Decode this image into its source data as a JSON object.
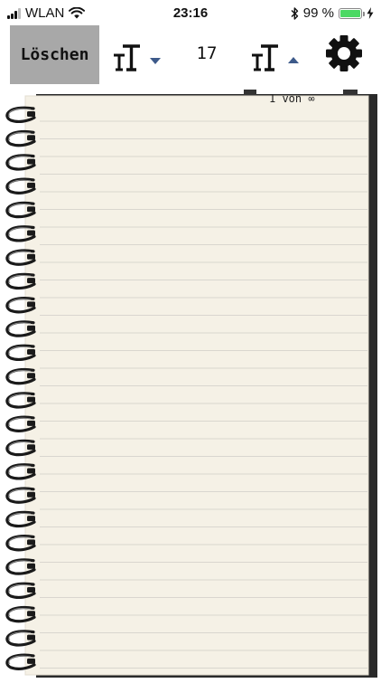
{
  "status_bar": {
    "carrier": "WLAN",
    "time": "23:16",
    "battery_percent": "99 %",
    "battery_level": 0.99,
    "icons": [
      "signal-icon",
      "wifi-icon",
      "bluetooth-icon",
      "battery-icon",
      "charging-icon"
    ]
  },
  "toolbar": {
    "clear_label": "Löschen",
    "font_size": "17",
    "icons": [
      "decrease-font-icon",
      "increase-font-icon",
      "settings-gear-icon"
    ]
  },
  "notebook": {
    "page_indicator": "1 von ∞"
  },
  "colors": {
    "clear_button_bg": "#a8a8a8",
    "paper": "#f5f1e6",
    "rule_line": "#d9d6cf",
    "arrow": "#3d5a8a",
    "battery_fill": "#4cd964"
  }
}
